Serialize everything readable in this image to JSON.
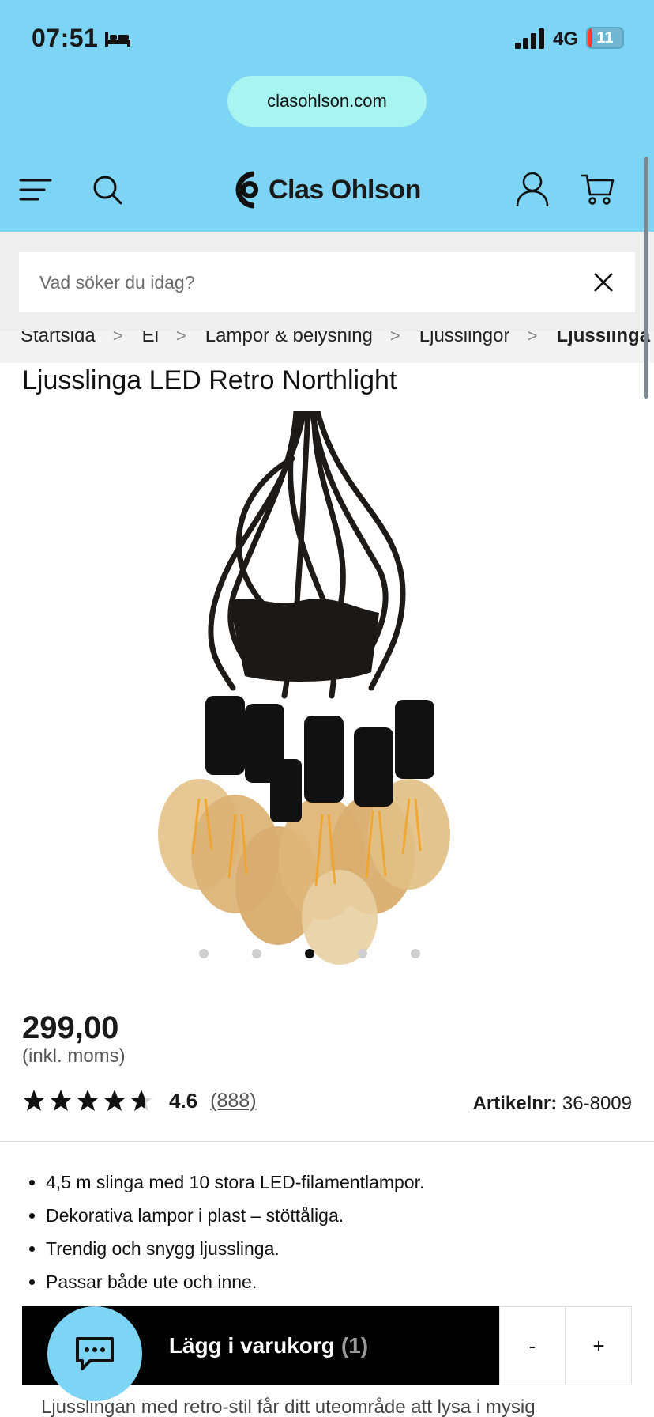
{
  "status": {
    "time": "07:51",
    "network": "4G",
    "battery": "11",
    "battery_level": 0.11
  },
  "browser": {
    "url": "clasohlson.com"
  },
  "header": {
    "brand": "Clas Ohlson"
  },
  "search": {
    "placeholder": "Vad söker du idag?"
  },
  "breadcrumb": [
    {
      "label": "Startsida"
    },
    {
      "label": "El"
    },
    {
      "label": "Lampor & belysning"
    },
    {
      "label": "Ljusslingor"
    },
    {
      "label": "Ljusslinga LED Retro Northlight"
    }
  ],
  "product": {
    "title": "Ljusslinga LED Retro Northlight",
    "price": "299,00",
    "vat": "(inkl. moms)",
    "rating": "4.6",
    "rating_value": 4.6,
    "review_count": "(888)",
    "article_label": "Artikelnr:",
    "article_number": "36-8009",
    "image_count": 5,
    "active_image": 3,
    "bullets": [
      "4,5 m slinga med 10 stora LED-filamentlampor.",
      "Dekorativa lampor i plast – stöttåliga.",
      "Trendig och snygg ljusslinga.",
      "Passar både ute och inne."
    ],
    "description_preview": "Ljusslingan med retro-stil får ditt uteområde att lysa i mysig"
  },
  "cart": {
    "add_label": "Lägg i varukorg",
    "quantity": "(1)",
    "minus": "-",
    "plus": "+"
  },
  "icons": {
    "menu": "menu-icon",
    "search": "search-icon",
    "user": "user-icon",
    "cart": "cart-icon",
    "close": "close-icon",
    "chat": "chat-icon"
  },
  "colors": {
    "header_bg": "#7dd4f5",
    "url_pill": "#a7f4f0",
    "button": "#000000"
  }
}
